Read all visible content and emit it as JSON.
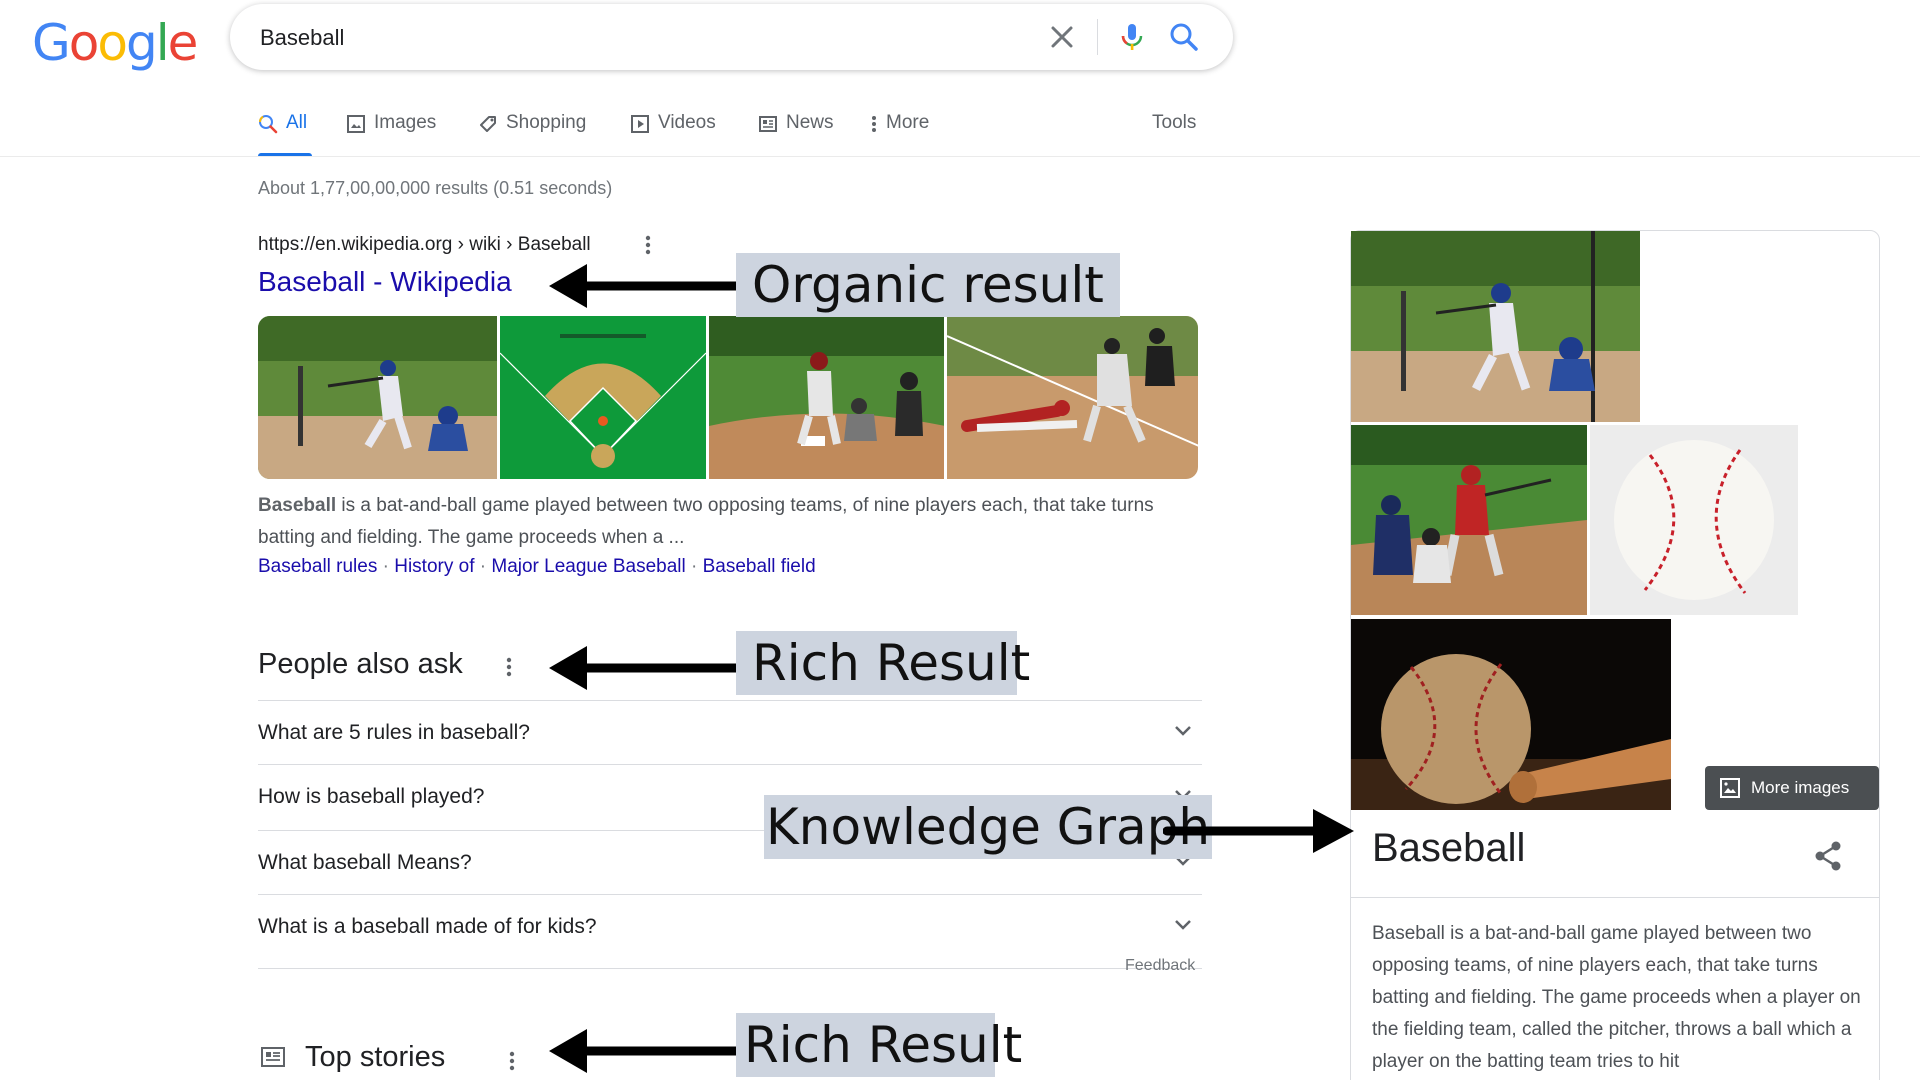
{
  "brand": {
    "logo_letters": [
      "G",
      "o",
      "o",
      "g",
      "l",
      "e"
    ],
    "logo_colors": [
      "#4285F4",
      "#EA4335",
      "#FBBC05",
      "#4285F4",
      "#34A853",
      "#EA4335"
    ]
  },
  "search": {
    "query": "Baseball"
  },
  "tabs": [
    {
      "label": "All",
      "icon": "search-icon"
    },
    {
      "label": "Images",
      "icon": "image-icon"
    },
    {
      "label": "Shopping",
      "icon": "tag-icon"
    },
    {
      "label": "Videos",
      "icon": "play-icon"
    },
    {
      "label": "News",
      "icon": "newspaper-icon"
    },
    {
      "label": "More",
      "icon": "kebab-icon"
    }
  ],
  "tools_label": "Tools",
  "result_stats": "About 1,77,00,00,000 results (0.51 seconds)",
  "organic_result": {
    "breadcrumb": "https://en.wikipedia.org › wiki › Baseball",
    "title": "Baseball - Wikipedia",
    "snippet_bold": "Baseball",
    "snippet_rest": " is a bat-and-ball game played between two opposing teams, of nine players each, that take turns batting and fielding. The game proceeds when a ...",
    "sitelinks": [
      "Baseball rules",
      "History of",
      "Major League Baseball",
      "Baseball field"
    ],
    "sitelink_separator": " · "
  },
  "people_also_ask": {
    "title": "People also ask",
    "questions": [
      "What are 5 rules in baseball?",
      "How is baseball played?",
      "What baseball Means?",
      "What is a baseball made of for kids?"
    ],
    "feedback_label": "Feedback"
  },
  "top_stories": {
    "title": "Top stories"
  },
  "knowledge_panel": {
    "title": "Baseball",
    "more_images_label": "More images",
    "description": "Baseball is a bat-and-ball game played between two opposing teams, of nine players each, that take turns batting and fielding. The game proceeds when a player on the fielding team, called the pitcher, throws a ball which a player on the batting team tries to hit"
  },
  "annotations": {
    "organic": "Organic result",
    "rich_1": "Rich Result",
    "knowledge": "Knowledge Graph",
    "rich_2": "Rich Result"
  },
  "colors": {
    "link": "#1a0dab",
    "accent": "#1a73e8",
    "callout_bg": "#cdd4df"
  }
}
